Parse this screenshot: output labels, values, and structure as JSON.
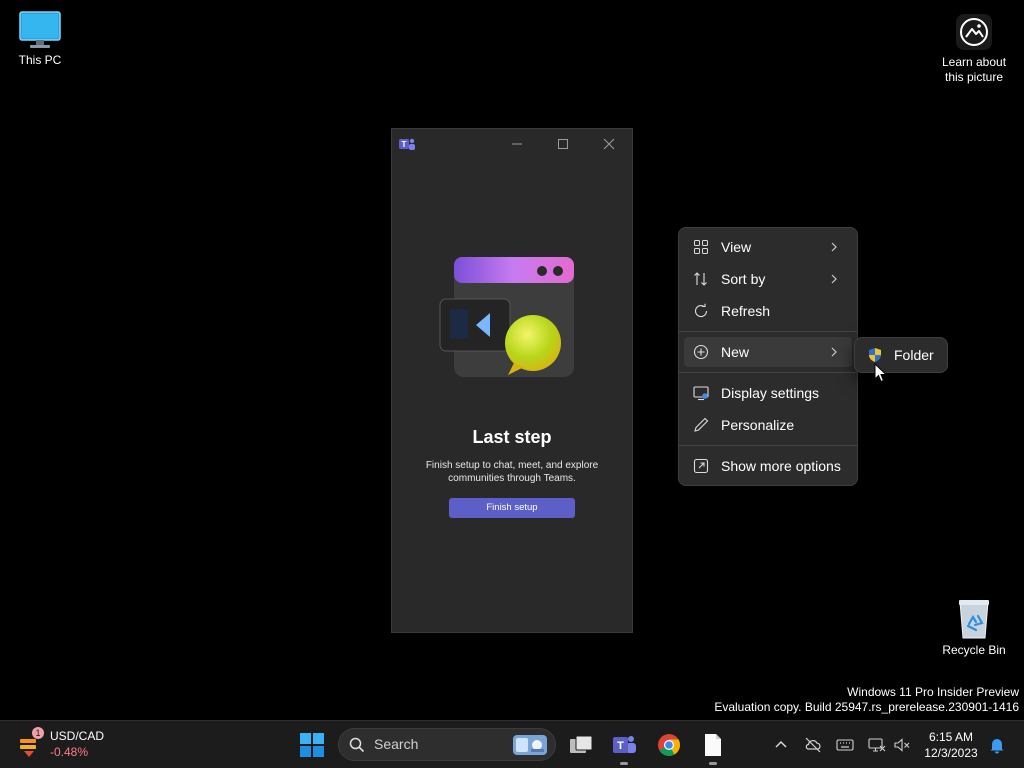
{
  "desktop": {
    "this_pc": "This PC",
    "learn_line1": "Learn about",
    "learn_line2": "this picture",
    "recycle_bin": "Recycle Bin"
  },
  "teams_window": {
    "heading": "Last step",
    "description": "Finish setup to chat, meet, and explore communities through Teams.",
    "button": "Finish setup",
    "accent": "#5b5fc7"
  },
  "context_menu": {
    "items": [
      {
        "label": "View",
        "icon": "grid-icon",
        "submenu": true
      },
      {
        "label": "Sort by",
        "icon": "sort-icon",
        "submenu": true
      },
      {
        "label": "Refresh",
        "icon": "refresh-icon",
        "submenu": false
      },
      {
        "label": "New",
        "icon": "plus-circle-icon",
        "submenu": true
      },
      {
        "label": "Display settings",
        "icon": "display-icon",
        "submenu": false
      },
      {
        "label": "Personalize",
        "icon": "pen-icon",
        "submenu": false
      },
      {
        "label": "Show more options",
        "icon": "expand-icon",
        "submenu": false
      }
    ],
    "hovered": "New"
  },
  "submenu": {
    "label": "Folder",
    "icon": "shield-folder-icon"
  },
  "watermark": {
    "line1": "Windows 11 Pro Insider Preview",
    "line2": "Evaluation copy. Build 25947.rs_prerelease.230901-1416"
  },
  "taskbar": {
    "widget_name": "USD/CAD",
    "widget_change": "-0.48%",
    "widget_badge": "1",
    "search_placeholder": "Search",
    "time": "6:15 AM",
    "date": "12/3/2023"
  }
}
